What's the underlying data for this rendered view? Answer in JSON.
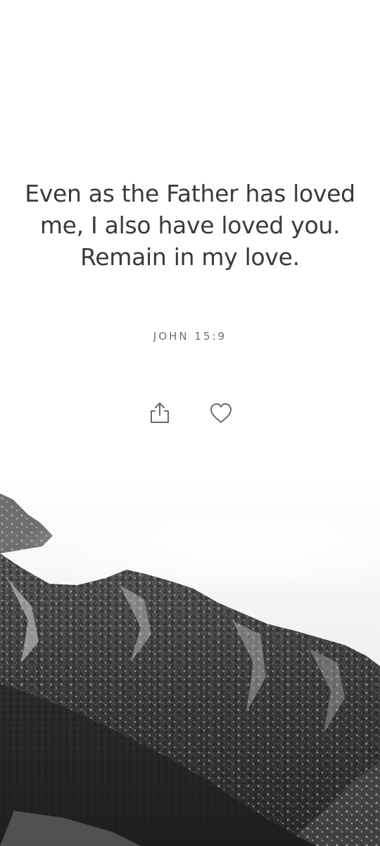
{
  "verse": {
    "text": "Even as the Father has loved me, I also have loved you. Remain in my love.",
    "reference": "JOHN 15:9"
  },
  "actions": {
    "share_icon": "share-icon",
    "like_icon": "heart-icon"
  },
  "background": {
    "image": "snowy-mountain-landscape",
    "tone": "grayscale"
  },
  "colors": {
    "background": "#ffffff",
    "quote_text": "#3a3a3a",
    "reference_text": "#6f6f6f",
    "icon": "#6a6a6a"
  }
}
